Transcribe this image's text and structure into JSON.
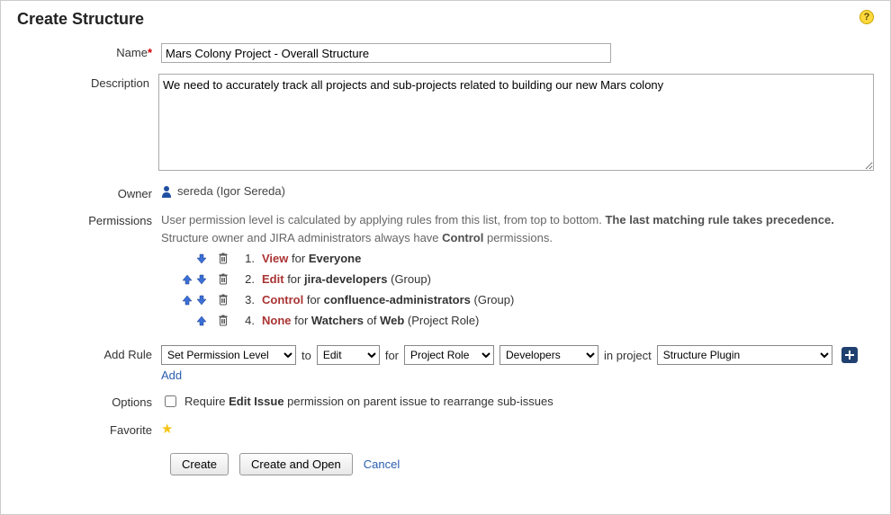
{
  "header": {
    "title": "Create Structure"
  },
  "fields": {
    "name_label": "Name",
    "name_value": "Mars Colony Project - Overall Structure",
    "description_label": "Description",
    "description_value": "We need to accurately track all projects and sub-projects related to building our new Mars colony",
    "owner_label": "Owner",
    "owner_value": "sereda (Igor Sereda)",
    "permissions_label": "Permissions",
    "permissions_help_1": "User permission level is calculated by applying rules from this list, from top to bottom. ",
    "permissions_help_strong": "The last matching rule takes precedence.",
    "permissions_help_2a": "Structure owner and JIRA administrators always have ",
    "permissions_help_2b": "Control",
    "permissions_help_2c": " permissions.",
    "addrule_label": "Add Rule",
    "options_label": "Options",
    "favorite_label": "Favorite"
  },
  "rules": [
    {
      "num": "1.",
      "level": "View",
      "for": "for",
      "target": "Everyone",
      "extra": "",
      "up": false,
      "down": true
    },
    {
      "num": "2.",
      "level": "Edit",
      "for": "for",
      "target": "jira-developers",
      "extra": "(Group)",
      "up": true,
      "down": true
    },
    {
      "num": "3.",
      "level": "Control",
      "for": "for",
      "target": "confluence-administrators",
      "extra": "(Group)",
      "up": true,
      "down": true
    },
    {
      "num": "4.",
      "level": "None",
      "for": "for",
      "target": "Watchers",
      "extra_pre": "of",
      "extra_target": "Web",
      "extra": "(Project Role)",
      "up": true,
      "down": false
    }
  ],
  "addrule": {
    "perm_level_selected": "Set Permission Level",
    "to_label": "to",
    "to_selected": "Edit",
    "for_label": "for",
    "scope_selected": "Project Role",
    "role_selected": "Developers",
    "inproject_label": "in project",
    "project_selected": "Structure Plugin",
    "add_link": "Add"
  },
  "options": {
    "checkbox_checked": false,
    "text_a": "Require ",
    "text_strong": "Edit Issue",
    "text_b": " permission on parent issue to rearrange sub-issues"
  },
  "actions": {
    "create": "Create",
    "create_open": "Create and Open",
    "cancel": "Cancel"
  }
}
